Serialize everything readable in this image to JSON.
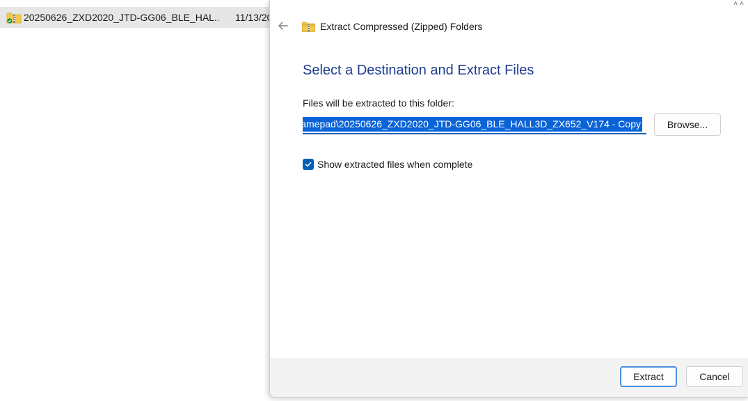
{
  "explorer": {
    "file_name": "20250626_ZXD2020_JTD-GG06_BLE_HAL...",
    "file_date": "11/13/20",
    "file_icon": "zip-folder-icon"
  },
  "dialog": {
    "back_icon": "back-arrow-icon",
    "title_icon": "zip-folder-icon",
    "title": "Extract Compressed (Zipped) Folders",
    "heading": "Select a Destination and Extract Files",
    "destination_label": "Files will be extracted to this folder:",
    "destination_path": "amepad\\20250626_ZXD2020_JTD-GG06_BLE_HALL3D_ZX652_V174 - Copy",
    "browse_label": "Browse...",
    "show_files_label": "Show extracted files when complete",
    "show_files_checked": true,
    "extract_label": "Extract",
    "cancel_label": "Cancel"
  },
  "colors": {
    "accent": "#005fb8",
    "selection": "#0a64d8",
    "heading": "#1c3d8f",
    "footer_bg": "#f3f3f3",
    "explorer_row_bg": "#e6e6e6"
  }
}
